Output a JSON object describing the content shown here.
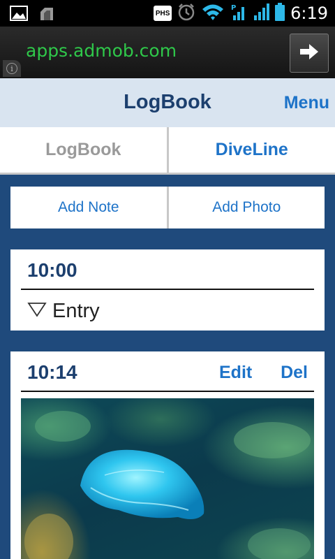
{
  "status_bar": {
    "time": "6:19",
    "carrier_badge": "PHS",
    "icons": [
      "gallery-icon",
      "usb-icon",
      "phs-icon",
      "alarm-icon",
      "wifi-icon",
      "signal-icon",
      "signal-icon",
      "battery-icon"
    ]
  },
  "ad": {
    "url": "apps.admob.com",
    "info_glyph": "i"
  },
  "header": {
    "title": "LogBook",
    "menu_label": "Menu"
  },
  "tabs": [
    {
      "label": "LogBook",
      "active": false
    },
    {
      "label": "DiveLine",
      "active": true
    }
  ],
  "actions": {
    "add_note": "Add Note",
    "add_photo": "Add Photo"
  },
  "entries": [
    {
      "time": "10:00",
      "label": "Entry"
    },
    {
      "time": "10:14",
      "edit_label": "Edit",
      "delete_label": "Del"
    }
  ],
  "colors": {
    "accent": "#1e73c8",
    "title": "#1c3f6e",
    "background": "#1f4a7c",
    "header_bg": "#d9e4f0",
    "ad_url": "#2fc84a"
  }
}
